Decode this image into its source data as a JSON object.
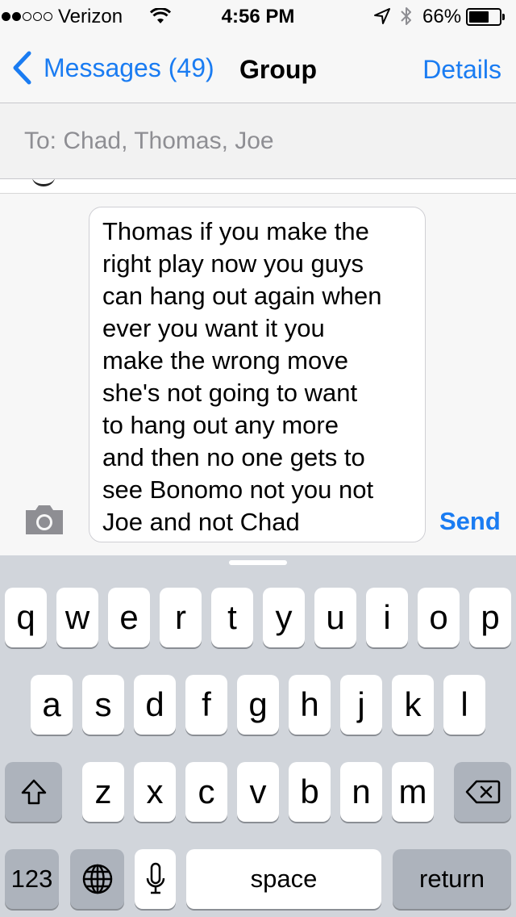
{
  "status_bar": {
    "carrier": "Verizon",
    "time": "4:56 PM",
    "battery": "66%",
    "signal_filled": 2,
    "signal_total": 5,
    "battery_level": 0.66
  },
  "nav": {
    "back_label": "Messages (49)",
    "title": "Group",
    "details_label": "Details"
  },
  "to_field": {
    "text": "To: Chad, Thomas, Joe"
  },
  "compose": {
    "message": "Thomas if you make the\nright play now you guys\ncan hang out again when\never you want it you\nmake the wrong move\nshe's not going to want\nto hang out any more\nand then no one gets to\nsee Bonomo not you not\nJoe and not Chad",
    "send_label": "Send"
  },
  "keyboard": {
    "row1": [
      "q",
      "w",
      "e",
      "r",
      "t",
      "y",
      "u",
      "i",
      "o",
      "p"
    ],
    "row2": [
      "a",
      "s",
      "d",
      "f",
      "g",
      "h",
      "j",
      "k",
      "l"
    ],
    "row3": [
      "z",
      "x",
      "c",
      "v",
      "b",
      "n",
      "m"
    ],
    "numbers_label": "123",
    "space_label": "space",
    "return_label": "return"
  },
  "colors": {
    "accent": "#1a7cf2",
    "keyboard_bg": "#d1d5db",
    "function_key": "#adb3bc"
  }
}
